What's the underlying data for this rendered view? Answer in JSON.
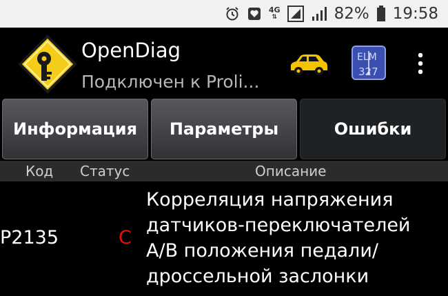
{
  "statusbar": {
    "signal_badge": "4G",
    "battery_percent": "82%",
    "time": "19:58"
  },
  "appbar": {
    "title": "OpenDiag",
    "subtitle": "Подключен к Proli..."
  },
  "tabs": [
    {
      "label": "Информация",
      "active": false
    },
    {
      "label": "Параметры",
      "active": false
    },
    {
      "label": "Ошибки",
      "active": true
    }
  ],
  "table": {
    "columns": [
      "Код",
      "Статус",
      "Описание"
    ],
    "rows": [
      {
        "code": "P2135",
        "status": "C",
        "description": "Корреляция напряжения датчиков-переключателей A/B положения педали/ дроссельной заслонки"
      }
    ]
  },
  "colors": {
    "status_bar_bg": "#f1f1f1",
    "status_red": "#e01010",
    "car_yellow": "#f5c400",
    "logo_yellow": "#f4cc1a"
  }
}
